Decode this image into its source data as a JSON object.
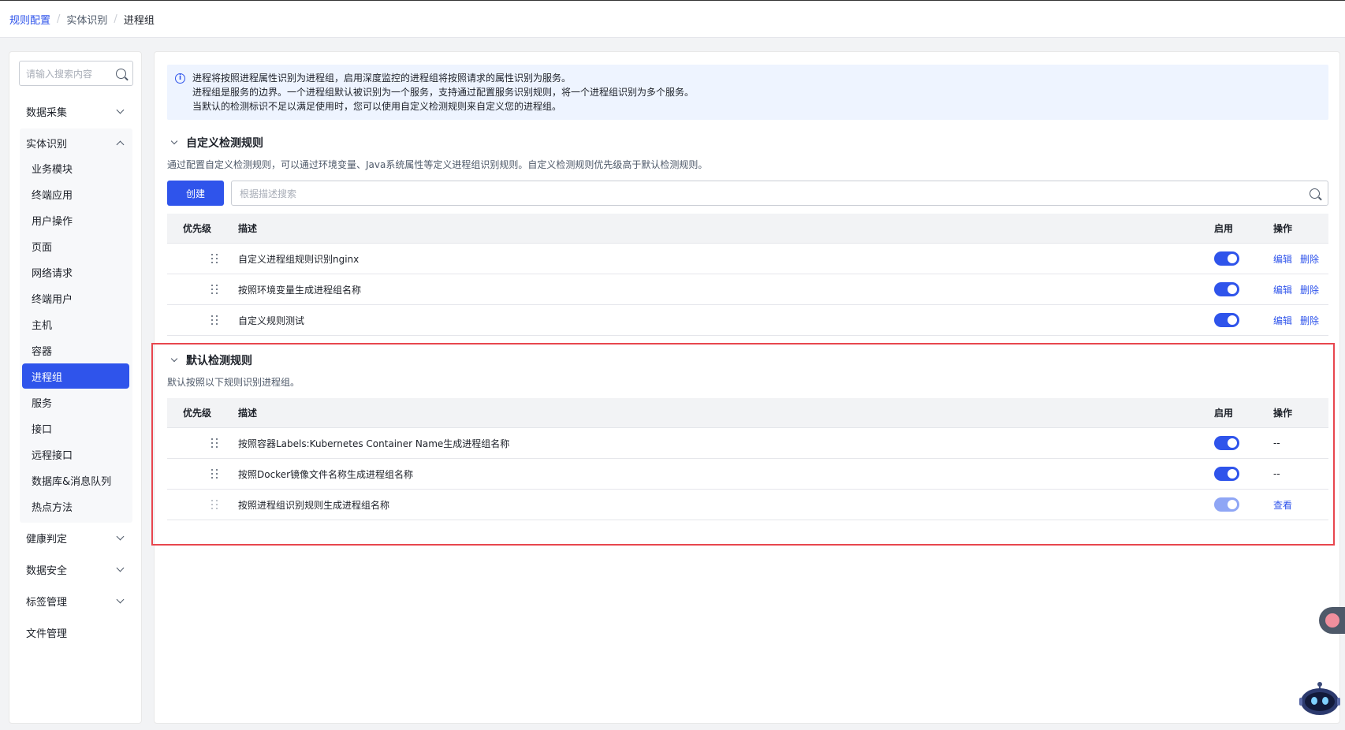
{
  "breadcrumb": {
    "root": "规则配置",
    "parent": "实体识别",
    "current": "进程组",
    "sep": "/"
  },
  "sidebar": {
    "search_placeholder": "请输入搜索内容",
    "groups": {
      "data_collect": "数据采集",
      "entity": "实体识别",
      "health": "健康判定",
      "security": "数据安全",
      "tags": "标签管理",
      "files": "文件管理"
    },
    "items": [
      "业务模块",
      "终端应用",
      "用户操作",
      "页面",
      "网络请求",
      "终端用户",
      "主机",
      "容器",
      "进程组",
      "服务",
      "接口",
      "远程接口",
      "数据库&消息队列",
      "热点方法"
    ],
    "active_item": "进程组"
  },
  "info": {
    "icon": "info-icon",
    "lines": [
      "进程将按照进程属性识别为进程组，启用深度监控的进程组将按照请求的属性识别为服务。",
      "进程组是服务的边界。一个进程组默认被识别为一个服务，支持通过配置服务识别规则，将一个进程组识别为多个服务。",
      "当默认的检测标识不足以满足使用时，您可以使用自定义检测规则来自定义您的进程组。"
    ]
  },
  "custom": {
    "title": "自定义检测规则",
    "desc": "通过配置自定义检测规则，可以通过环境变量、Java系统属性等定义进程组识别规则。自定义检测规则优先级高于默认检测规则。",
    "create_label": "创建",
    "search_placeholder": "根据描述搜索",
    "columns": {
      "priority": "优先级",
      "desc": "描述",
      "enabled": "启用",
      "ops": "操作"
    },
    "rows": [
      {
        "desc": "自定义进程组规则识别nginx",
        "edit": "编辑",
        "delete": "删除"
      },
      {
        "desc": "按照环境变量生成进程组名称",
        "edit": "编辑",
        "delete": "删除"
      },
      {
        "desc": "自定义规则测试",
        "edit": "编辑",
        "delete": "删除"
      }
    ]
  },
  "default": {
    "title": "默认检测规则",
    "desc": "默认按照以下规则识别进程组。",
    "columns": {
      "priority": "优先级",
      "desc": "描述",
      "enabled": "启用",
      "ops": "操作"
    },
    "rows": [
      {
        "desc": "按照容器Labels:Kubernetes Container Name生成进程组名称",
        "op": "--"
      },
      {
        "desc": "按照Docker镜像文件名称生成进程组名称",
        "op": "--"
      },
      {
        "desc": "按照进程组识别规则生成进程组名称",
        "op": "查看"
      }
    ]
  },
  "colors": {
    "accent": "#2f54eb",
    "highlight": "#e8464e",
    "info_bg": "#eef4ff"
  }
}
